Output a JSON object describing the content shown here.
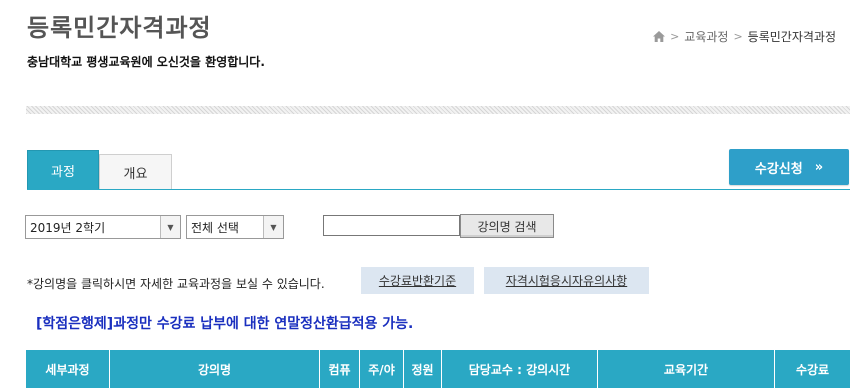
{
  "header": {
    "title": "등록민간자격과정",
    "welcome": "충남대학교 평생교육원에 오신것을 환영합니다."
  },
  "breadcrumb": {
    "home_icon": "home-icon",
    "sep": ">",
    "items": [
      "교육과정",
      "등록민간자격과정"
    ]
  },
  "tabs": [
    {
      "label": "과정",
      "active": true
    },
    {
      "label": "개요",
      "active": false
    }
  ],
  "apply_button": {
    "label": "수강신청",
    "arrow": "»"
  },
  "filters": {
    "semester": {
      "selected": "2019년 2학기"
    },
    "category": {
      "selected": "전체 선택"
    },
    "search": {
      "value": "",
      "button_label": "강의명 검색"
    }
  },
  "notice": {
    "text": "*강의명을 클릭하시면 자세한 교육과정을 보실 수 있습니다.",
    "refund_label": "수강료반환기준",
    "exam_label": "자격시험응시자유의사항"
  },
  "credit_notice": "[학점은행제]과정만 수강료 납부에 대한 연말정산환급적용 가능.",
  "table": {
    "columns": [
      "세부과정",
      "강의명",
      "컴퓨",
      "주/야",
      "정원",
      "담당교수 : 강의시간",
      "교육기간",
      "수강료"
    ]
  },
  "colors": {
    "accent": "#2aa8c4",
    "apply_button": "#2e9fc9",
    "link_button_bg": "#dce6f1",
    "credit_notice": "#1a2fbf"
  }
}
